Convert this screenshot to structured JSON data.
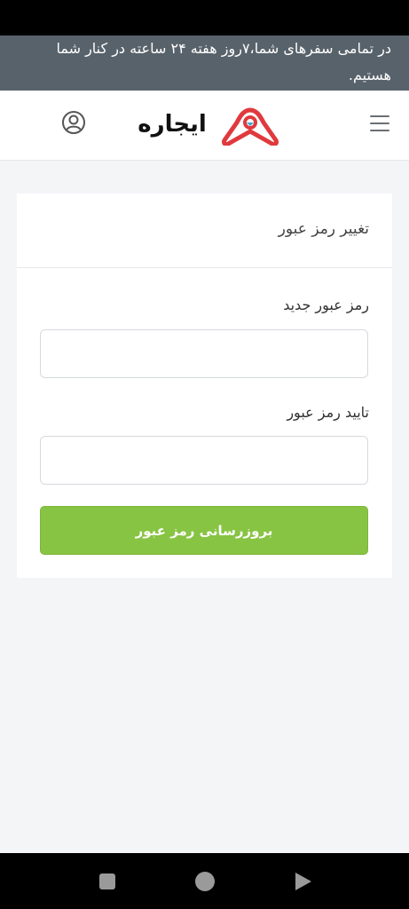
{
  "banner": {
    "text": "در تمامی سفرهای شما،۷روز هفته ۲۴ ساعته در کنار شما هستیم."
  },
  "header": {
    "logo_text": "ایجاره",
    "menu_icon": "hamburger-menu-icon",
    "profile_icon": "user-profile-icon"
  },
  "card": {
    "title": "تغییر رمز عبور",
    "new_password_label": "رمز عبور جدید",
    "new_password_value": "",
    "confirm_password_label": "تایید رمز عبور",
    "confirm_password_value": "",
    "submit_label": "بروزرسانی رمز عبور"
  },
  "colors": {
    "banner_bg": "#58626b",
    "submit_bg": "#88c443",
    "logo_red": "#e03a3e",
    "page_bg": "#f4f5f7"
  },
  "system_nav": {
    "recents_icon": "square-icon",
    "home_icon": "circle-icon",
    "back_icon": "triangle-back-icon"
  }
}
